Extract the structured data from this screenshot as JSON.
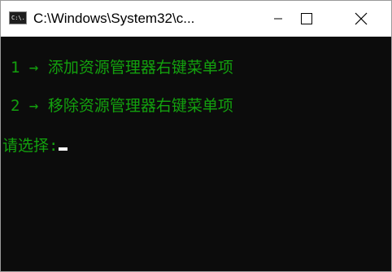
{
  "window": {
    "title": "C:\\Windows\\System32\\c...",
    "icon_text": "C:\\.",
    "controls": {
      "minimize": "minimize-icon",
      "maximize": "maximize-icon",
      "close": "close-icon"
    }
  },
  "console": {
    "text_color": "#13a10e",
    "background": "#0c0c0c",
    "lines": [
      {
        "number": "1",
        "arrow": "→",
        "text": "添加资源管理器右键菜单项"
      },
      {
        "number": "2",
        "arrow": "→",
        "text": "移除资源管理器右键菜单项"
      }
    ],
    "prompt": "请选择:"
  }
}
